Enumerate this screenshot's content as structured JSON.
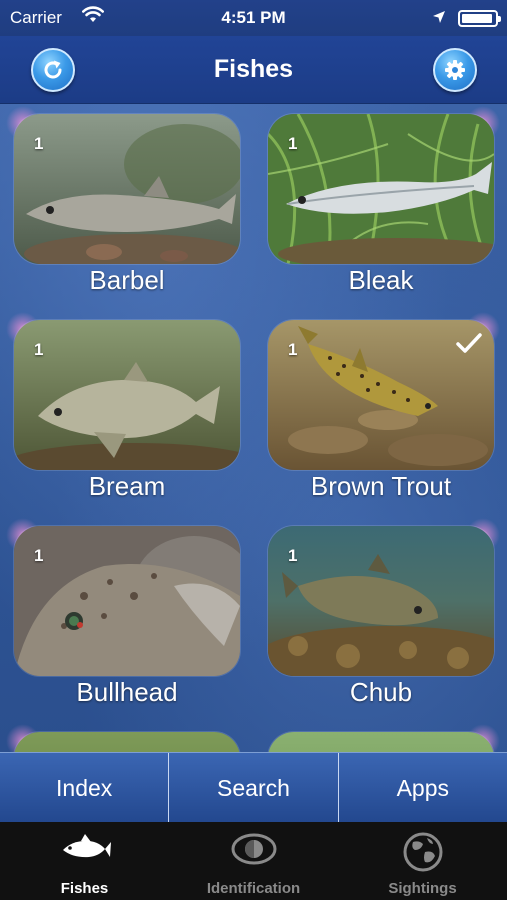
{
  "status_bar": {
    "carrier": "Carrier",
    "time": "4:51 PM",
    "icons": [
      "wifi-icon",
      "location-arrow-icon",
      "battery-icon"
    ]
  },
  "nav": {
    "title": "Fishes",
    "left_button_icon": "refresh-icon",
    "right_button_icon": "gear-icon"
  },
  "fishes": [
    {
      "name": "Barbel",
      "count": "1",
      "checked": false
    },
    {
      "name": "Bleak",
      "count": "1",
      "checked": false
    },
    {
      "name": "Bream",
      "count": "1",
      "checked": false
    },
    {
      "name": "Brown Trout",
      "count": "1",
      "checked": true
    },
    {
      "name": "Bullhead",
      "count": "1",
      "checked": false
    },
    {
      "name": "Chub",
      "count": "1",
      "checked": false
    }
  ],
  "segments": [
    "Index",
    "Search",
    "Apps"
  ],
  "tabs": [
    {
      "label": "Fishes",
      "icon": "fish-icon",
      "active": true
    },
    {
      "label": "Identification",
      "icon": "eye-icon",
      "active": false
    },
    {
      "label": "Sightings",
      "icon": "globe-icon",
      "active": false
    }
  ],
  "colors": {
    "nav_background": "#1f3d80",
    "content_background": "#2f5596",
    "tab_bar_background": "#111111",
    "tab_active": "#ffffff",
    "tab_inactive": "#8a8a8a"
  }
}
